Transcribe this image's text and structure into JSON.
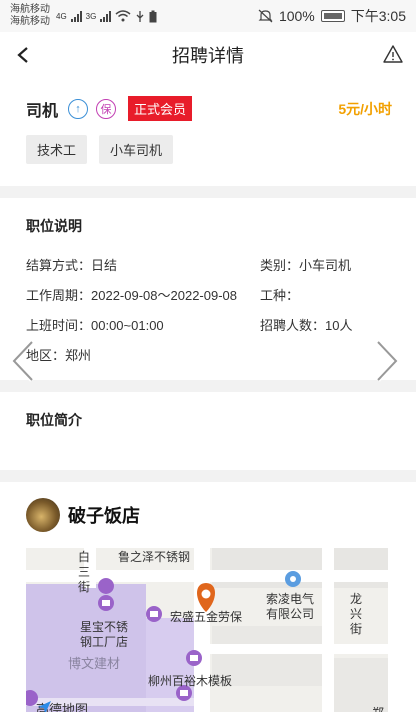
{
  "status_bar": {
    "carrier1": "海航移动",
    "carrier2": "海航移动",
    "net1": "4G",
    "net2": "3G",
    "battery": "100%",
    "time": "下午3:05"
  },
  "nav": {
    "title": "招聘详情"
  },
  "job": {
    "title": "司机",
    "badge_up": "↑",
    "badge_bao": "保",
    "member_label": "正式会员",
    "salary": "5元/小时",
    "tags": [
      "技术工",
      "小车司机"
    ]
  },
  "position": {
    "section_title": "职位说明",
    "settlement": "结算方式：日结",
    "category": "类别：小车司机",
    "period": "工作周期：2022-09-08～2022-09-08",
    "work_type": "工种：",
    "hours": "上班时间：00:00~01:00",
    "headcount": "招聘人数：10人",
    "area": "地区：郑州"
  },
  "brief": {
    "section_title": "职位简介"
  },
  "shop": {
    "name": "破子饭店",
    "map": {
      "labels": {
        "road_top": "鲁之泽不锈钢",
        "street_left": "白\n三\n街",
        "hongsheng": "宏盛五金劳保",
        "suoling": "索凌电气\n有限公司",
        "longxing": "龙\n兴\n街",
        "xingbao": "星宝不锈\n钢工厂店",
        "bowen": "博文建材",
        "liuzhou": "柳州百裕木模板",
        "zheng": "郑"
      },
      "logo": "高德地图"
    }
  }
}
